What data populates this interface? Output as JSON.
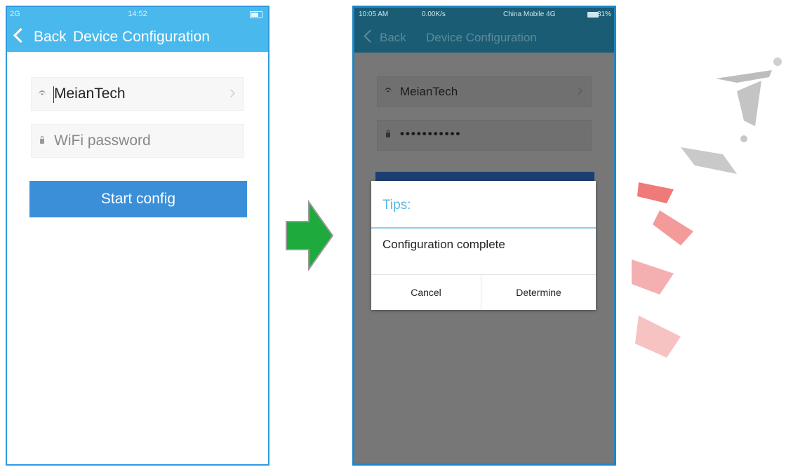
{
  "phone1": {
    "status": {
      "signal": "2G",
      "time": "14:52"
    },
    "nav": {
      "back_label": "Back",
      "title": "Device Configuration"
    },
    "ssid": "MeianTech",
    "password_placeholder": "WiFi password",
    "start_button": "Start config"
  },
  "phone2": {
    "status": {
      "time": "10:05 AM",
      "speed": "0.00K/s",
      "carrier": "China Mobile 4G",
      "battery": "81%"
    },
    "nav": {
      "back_label": "Back",
      "title": "Device Configuration"
    },
    "ssid": "MeianTech",
    "password_mask": "•••••••••••",
    "dialog": {
      "title": "Tips:",
      "message": "Configuration complete",
      "cancel": "Cancel",
      "confirm": "Determine"
    }
  },
  "colors": {
    "header_blue": "#49b8ec",
    "button_blue": "#3a8fd8",
    "arrow_green": "#1faa3e",
    "dialog_title": "#57b6e4"
  }
}
